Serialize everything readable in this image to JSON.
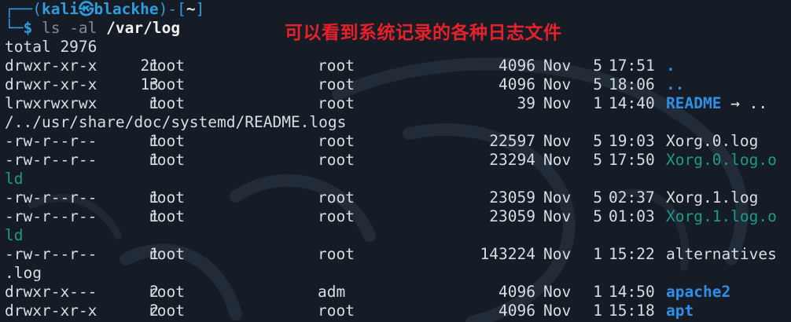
{
  "prompt": {
    "user": "kali",
    "host": "blackhe",
    "cwd": "~",
    "command": "ls -al",
    "argument": "/var/log"
  },
  "annotation": "可以看到系统记录的各种日志文件",
  "total_line": "total 2976",
  "entries": [
    {
      "perm": "drwxr-xr-x",
      "links": "21",
      "owner": "root",
      "group": "root",
      "size": "4096",
      "month": "Nov",
      "day": "5",
      "time": "17:51",
      "name": ".",
      "type": "dir"
    },
    {
      "perm": "drwxr-xr-x",
      "links": "13",
      "owner": "root",
      "group": "root",
      "size": "4096",
      "month": "Nov",
      "day": "5",
      "time": "18:06",
      "name": "..",
      "type": "dir"
    },
    {
      "perm": "lrwxrwxrwx",
      "links": "1",
      "owner": "root",
      "group": "root",
      "size": "39",
      "month": "Nov",
      "day": "1",
      "time": "14:40",
      "name": "README",
      "target_arrow": "→ ..",
      "wrap": "/../usr/share/doc/systemd/README.logs",
      "type": "link"
    },
    {
      "perm": "-rw-r--r--",
      "links": "1",
      "owner": "root",
      "group": "root",
      "size": "22597",
      "month": "Nov",
      "day": "5",
      "time": "19:03",
      "name": "Xorg.0.log",
      "type": "file"
    },
    {
      "perm": "-rw-r--r--",
      "links": "1",
      "owner": "root",
      "group": "root",
      "size": "23294",
      "month": "Nov",
      "day": "5",
      "time": "17:50",
      "name": "Xorg.0.log.o",
      "wrap": "ld",
      "type": "old"
    },
    {
      "perm": "-rw-r--r--",
      "links": "1",
      "owner": "root",
      "group": "root",
      "size": "23059",
      "month": "Nov",
      "day": "5",
      "time": "02:37",
      "name": "Xorg.1.log",
      "type": "file"
    },
    {
      "perm": "-rw-r--r--",
      "links": "1",
      "owner": "root",
      "group": "root",
      "size": "23059",
      "month": "Nov",
      "day": "5",
      "time": "01:03",
      "name": "Xorg.1.log.o",
      "wrap": "ld",
      "type": "old"
    },
    {
      "perm": "-rw-r--r--",
      "links": "1",
      "owner": "root",
      "group": "root",
      "size": "143224",
      "month": "Nov",
      "day": "1",
      "time": "15:22",
      "name": "alternatives",
      "wrap": ".log",
      "type": "file"
    },
    {
      "perm": "drwxr-x---",
      "links": "2",
      "owner": "root",
      "group": "adm",
      "size": "4096",
      "month": "Nov",
      "day": "1",
      "time": "14:50",
      "name": "apache2",
      "type": "dir"
    },
    {
      "perm": "drwxr-xr-x",
      "links": "2",
      "owner": "root",
      "group": "root",
      "size": "4096",
      "month": "Nov",
      "day": "1",
      "time": "15:18",
      "name": "apt",
      "type": "dir"
    }
  ]
}
